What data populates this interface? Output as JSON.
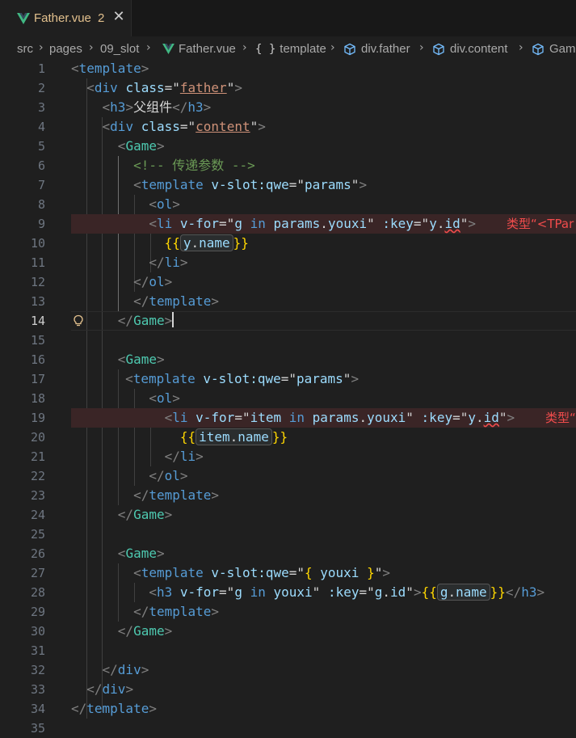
{
  "tab": {
    "icon": "vue-logo-icon",
    "filename": "Father.vue",
    "problem_count": "2",
    "close_symbol": "✕"
  },
  "breadcrumb": {
    "items": [
      "src",
      "pages",
      "09_slot",
      "Father.vue",
      "template",
      "div.father",
      "div.content",
      "Gam"
    ],
    "braces": "{ }"
  },
  "colors": {
    "tab_text": "#e2c08d",
    "error": "#f14c4c",
    "vue_green": "#41b883"
  },
  "editor": {
    "active_line": 14,
    "line_numbers": [
      "1",
      "2",
      "3",
      "4",
      "5",
      "6",
      "7",
      "8",
      "9",
      "10",
      "11",
      "12",
      "13",
      "14",
      "15",
      "16",
      "17",
      "18",
      "19",
      "20",
      "21",
      "22",
      "23",
      "24",
      "25",
      "26",
      "27",
      "28",
      "29",
      "30",
      "31",
      "32",
      "33",
      "34",
      "35"
    ],
    "lint_line_9": "类型“<TPar",
    "lint_line_19": "类型“",
    "lines": {
      "l1": {
        "lt": "<",
        "tag": "template",
        "gt": ">"
      },
      "l2": {
        "lt": "<",
        "tag": "div",
        "attr": "class",
        "eq": "=\"",
        "val": "father",
        "q": "\"",
        "gt": ">"
      },
      "l3": {
        "lt": "<",
        "tag": "h3",
        "gt": ">",
        "text": "父组件",
        "clt": "</",
        "ctag": "h3",
        "cgt": ">"
      },
      "l4": {
        "lt": "<",
        "tag": "div",
        "attr": "class",
        "eq": "=\"",
        "val": "content",
        "q": "\"",
        "gt": ">"
      },
      "l5": {
        "lt": "<",
        "tag": "Game",
        "gt": ">"
      },
      "l6": {
        "comment": "<!-- 传递参数 -->"
      },
      "l7": {
        "lt": "<",
        "tag": "template",
        "attr": "v-slot:qwe",
        "eq": "=\"",
        "val": "params",
        "q": "\"",
        "gt": ">"
      },
      "l8": {
        "lt": "<",
        "tag": "ol",
        "gt": ">"
      },
      "l9": {
        "lt": "<",
        "tag": "li",
        "attr1": "v-for",
        "eq1": "=\"",
        "v1": "g",
        "kw": "in",
        "v2": "params",
        "dot": ".",
        "v3": "youxi",
        "q1": "\"",
        "attr2": ":key",
        "eq2": "=\"",
        "v4": "y",
        "dot2": ".",
        "v5": "id",
        "q2": "\"",
        "gt": ">"
      },
      "l10": {
        "ob": "{{",
        "expr_a": "y",
        "dot": ".",
        "expr_b": "name",
        "cb": "}}"
      },
      "l11": {
        "lt": "</",
        "tag": "li",
        "gt": ">"
      },
      "l12": {
        "lt": "</",
        "tag": "ol",
        "gt": ">"
      },
      "l13": {
        "lt": "</",
        "tag": "template",
        "gt": ">"
      },
      "l14": {
        "lt": "</",
        "tag": "Game",
        "gt": ">"
      },
      "l16": {
        "lt": "<",
        "tag": "Game",
        "gt": ">"
      },
      "l17": {
        "lt": "<",
        "tag": "template",
        "attr": "v-slot:qwe",
        "eq": "=\"",
        "val": "params",
        "q": "\"",
        "gt": ">"
      },
      "l18": {
        "lt": "<",
        "tag": "ol",
        "gt": ">"
      },
      "l19": {
        "lt": "<",
        "tag": "li",
        "attr1": "v-for",
        "eq1": "=\"",
        "v1": "item",
        "kw": "in",
        "v2": "params",
        "dot": ".",
        "v3": "youxi",
        "q1": "\"",
        "attr2": ":key",
        "eq2": "=\"",
        "v4": "y",
        "dot2": ".",
        "v5": "id",
        "q2": "\"",
        "gt": ">"
      },
      "l20": {
        "ob": "{{",
        "expr_a": "item",
        "dot": ".",
        "expr_b": "name",
        "cb": "}}"
      },
      "l21": {
        "lt": "</",
        "tag": "li",
        "gt": ">"
      },
      "l22": {
        "lt": "</",
        "tag": "ol",
        "gt": ">"
      },
      "l23": {
        "lt": "</",
        "tag": "template",
        "gt": ">"
      },
      "l24": {
        "lt": "</",
        "tag": "Game",
        "gt": ">"
      },
      "l26": {
        "lt": "<",
        "tag": "Game",
        "gt": ">"
      },
      "l27": {
        "lt": "<",
        "tag": "template",
        "attr": "v-slot:qwe",
        "eq": "=\"",
        "ob": "{ ",
        "val": "youxi",
        "cb": " }",
        "q": "\"",
        "gt": ">"
      },
      "l28": {
        "lt": "<",
        "tag": "h3",
        "attr1": "v-for",
        "eq1": "=\"",
        "v1": "g",
        "kw": "in",
        "v2": "youxi",
        "q1": "\"",
        "attr2": ":key",
        "eq2": "=\"",
        "v4": "g",
        "dot2": ".",
        "v5": "id",
        "q2": "\"",
        "gt": ">",
        "ob": "{{",
        "expr_a": "g",
        "dot": ".",
        "expr_b": "name",
        "cb": "}}",
        "clt": "</",
        "ctag": "h3",
        "cgt": ">"
      },
      "l29": {
        "lt": "</",
        "tag": "template",
        "gt": ">"
      },
      "l30": {
        "lt": "</",
        "tag": "Game",
        "gt": ">"
      },
      "l32": {
        "lt": "</",
        "tag": "div",
        "gt": ">"
      },
      "l33": {
        "lt": "</",
        "tag": "div",
        "gt": ">"
      },
      "l34": {
        "lt": "</",
        "tag": "template",
        "gt": ">"
      }
    }
  }
}
